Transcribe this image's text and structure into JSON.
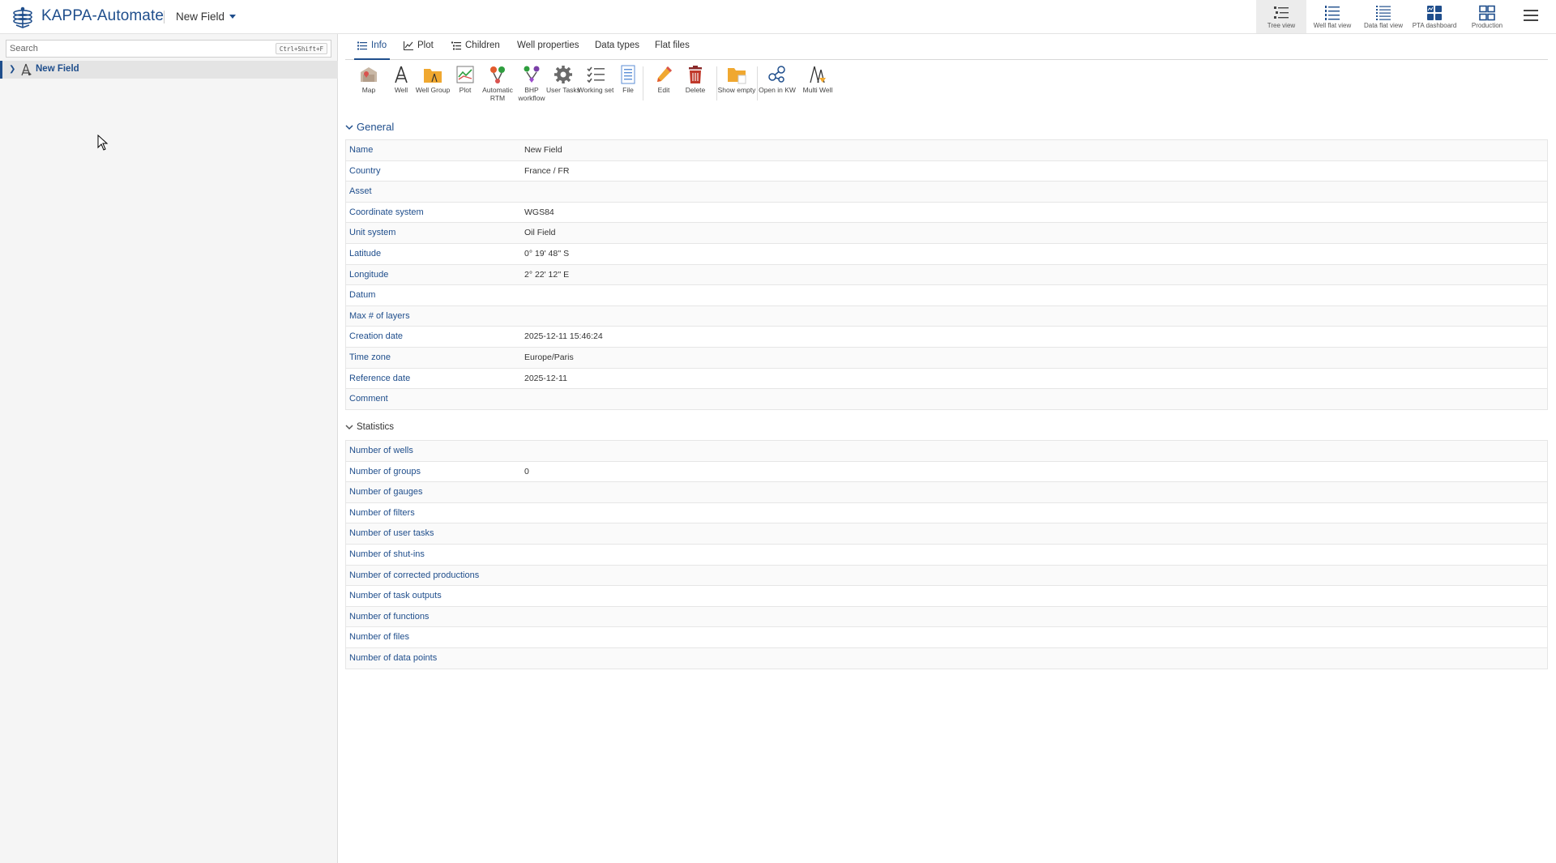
{
  "header": {
    "app_title": "KAPPA-Automate",
    "field_selector": "New Field",
    "views": [
      {
        "label": "Tree view",
        "active": true
      },
      {
        "label": "Well flat view",
        "active": false
      },
      {
        "label": "Data flat view",
        "active": false
      },
      {
        "label": "PTA dashboard",
        "active": false
      },
      {
        "label": "Production",
        "active": false
      }
    ]
  },
  "sidebar": {
    "search_placeholder": "Search",
    "search_shortcut": "Ctrl+Shift+F",
    "tree": [
      {
        "label": "New Field",
        "icon": "field-rig-icon",
        "expanded": false,
        "selected": true
      }
    ]
  },
  "tabs": [
    {
      "label": "Info",
      "icon": "list-icon",
      "active": true
    },
    {
      "label": "Plot",
      "icon": "line-chart-icon",
      "active": false
    },
    {
      "label": "Children",
      "icon": "children-list-icon",
      "active": false
    },
    {
      "label": "Well properties",
      "active": false
    },
    {
      "label": "Data types",
      "active": false
    },
    {
      "label": "Flat files",
      "active": false
    }
  ],
  "toolbar": [
    {
      "label": "Map",
      "icon": "map-icon"
    },
    {
      "label": "Well",
      "icon": "well-rig-icon"
    },
    {
      "label": "Well Group",
      "icon": "folder-well-icon"
    },
    {
      "label": "Plot",
      "icon": "plot-icon"
    },
    {
      "label": "Automatic RTM",
      "icon": "automatic-rtm-icon"
    },
    {
      "label": "BHP workflow",
      "icon": "bhp-workflow-icon"
    },
    {
      "label": "User Tasks",
      "icon": "gear-icon"
    },
    {
      "label": "Working set",
      "icon": "checklist-icon"
    },
    {
      "label": "File",
      "icon": "file-icon"
    },
    {
      "label": "Edit",
      "icon": "pencil-icon"
    },
    {
      "label": "Delete",
      "icon": "trash-icon"
    },
    {
      "label": "Show empty",
      "icon": "folder-empty-icon"
    },
    {
      "label": "Open in KW",
      "icon": "share-nodes-icon"
    },
    {
      "label": "Multi Well",
      "icon": "multi-well-icon"
    }
  ],
  "general": {
    "title": "General",
    "rows": [
      {
        "key": "Name",
        "value": "New Field"
      },
      {
        "key": "Country",
        "value": "France / FR"
      },
      {
        "key": "Asset",
        "value": ""
      },
      {
        "key": "Coordinate system",
        "value": "WGS84"
      },
      {
        "key": "Unit system",
        "value": "Oil Field"
      },
      {
        "key": "Latitude",
        "value": "0° 19' 48'' S"
      },
      {
        "key": "Longitude",
        "value": "2° 22' 12'' E"
      },
      {
        "key": "Datum",
        "value": ""
      },
      {
        "key": "Max # of layers",
        "value": ""
      },
      {
        "key": "Creation date",
        "value": "2025-12-11 15:46:24"
      },
      {
        "key": "Time zone",
        "value": "Europe/Paris"
      },
      {
        "key": "Reference date",
        "value": "2025-12-11"
      },
      {
        "key": "Comment",
        "value": ""
      }
    ]
  },
  "statistics": {
    "title": "Statistics",
    "rows": [
      {
        "key": "Number of wells",
        "value": ""
      },
      {
        "key": "Number of groups",
        "value": "0"
      },
      {
        "key": "Number of gauges",
        "value": ""
      },
      {
        "key": "Number of filters",
        "value": ""
      },
      {
        "key": "Number of user tasks",
        "value": ""
      },
      {
        "key": "Number of shut-ins",
        "value": ""
      },
      {
        "key": "Number of corrected productions",
        "value": ""
      },
      {
        "key": "Number of task outputs",
        "value": ""
      },
      {
        "key": "Number of functions",
        "value": ""
      },
      {
        "key": "Number of files",
        "value": ""
      },
      {
        "key": "Number of data points",
        "value": ""
      }
    ]
  },
  "colors": {
    "accent": "#1f4e8c",
    "selected_row": "#e4e4e4",
    "sidebar_bg": "#f5f5f5"
  }
}
